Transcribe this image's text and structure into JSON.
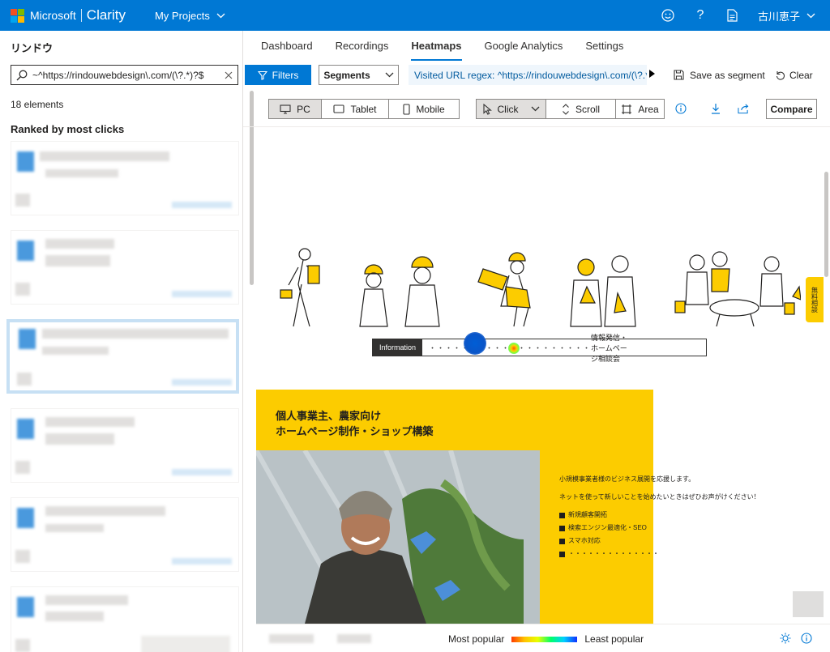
{
  "topbar": {
    "brand_ms": "Microsoft",
    "brand_app": "Clarity",
    "projects": "My Projects",
    "user": "古川恵子",
    "icons": [
      "smiley-icon",
      "help-icon",
      "document-icon",
      "chevron-down-icon"
    ]
  },
  "colors": {
    "accent": "#0078d4",
    "selection": "#c7e0f4",
    "site_yellow": "#fccc00"
  },
  "sidebar": {
    "site_name": "リンドウ",
    "search_value": "~^https://rindouwebdesign\\.com/(\\?.*)?$",
    "elements_count": "18 elements",
    "ranked_title": "Ranked by most clicks",
    "cards": [
      {
        "selected": false
      },
      {
        "selected": false
      },
      {
        "selected": true
      },
      {
        "selected": false
      },
      {
        "selected": false
      },
      {
        "selected": false
      }
    ]
  },
  "tabs": {
    "items": [
      "Dashboard",
      "Recordings",
      "Heatmaps",
      "Google Analytics",
      "Settings"
    ],
    "active": "Heatmaps"
  },
  "filters": {
    "filters_label": "Filters",
    "segments_label": "Segments",
    "chip": "Visited URL regex: ^https://rindouwebdesign\\.com/(\\?.*)?$",
    "save_segment": "Save as segment",
    "clear": "Clear"
  },
  "devices": {
    "pc": "PC",
    "tablet": "Tablet",
    "mobile": "Mobile",
    "active": "PC"
  },
  "modes": {
    "click": "Click",
    "scroll": "Scroll",
    "area": "Area",
    "active": "Click"
  },
  "compare_label": "Compare",
  "site": {
    "info_label": "Information",
    "info_text": "情報発信・ホームページ相談会",
    "title_line1": "個人事業主、農家向け",
    "title_line2": "ホームページ制作・ショップ構築",
    "copy1": "小規模事業者様のビジネス展開を応援します。",
    "copy2": "ネットを使って新しいことを始めたいときはぜひお声がけください！",
    "checks": [
      "新規顧客開拓",
      "検索エンジン最適化・SEO",
      "スマホ対応",
      "・・・・・・・・・・・・・・"
    ],
    "side_tab": "無料相談"
  },
  "legend": {
    "most": "Most popular",
    "least": "Least popular"
  }
}
